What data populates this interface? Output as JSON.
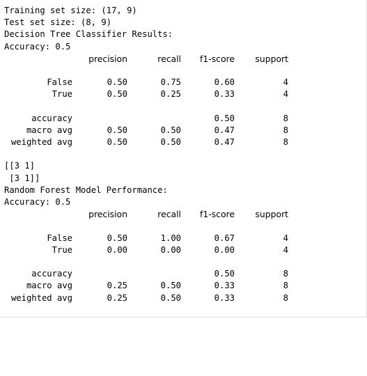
{
  "output": {
    "train_line": "Training set size: (17, 9)",
    "test_line": "Test set size: (8, 9)",
    "dt_title": "Decision Tree Classifier Results:",
    "dt_accuracy": "Accuracy: 0.5",
    "dt_report": {
      "headers": [
        "precision",
        "recall",
        "f1-score",
        "support"
      ],
      "rows": [
        {
          "label": "False",
          "precision": "0.50",
          "recall": "0.75",
          "f1": "0.60",
          "support": "4"
        },
        {
          "label": "True",
          "precision": "0.50",
          "recall": "0.25",
          "f1": "0.33",
          "support": "4"
        }
      ],
      "summary": [
        {
          "label": "accuracy",
          "precision": "",
          "recall": "",
          "f1": "0.50",
          "support": "8"
        },
        {
          "label": "macro avg",
          "precision": "0.50",
          "recall": "0.50",
          "f1": "0.47",
          "support": "8"
        },
        {
          "label": "weighted avg",
          "precision": "0.50",
          "recall": "0.50",
          "f1": "0.47",
          "support": "8"
        }
      ]
    },
    "confusion_line1": "[[3 1]",
    "confusion_line2": " [3 1]]",
    "rf_title": "Random Forest Model Performance:",
    "rf_accuracy": "Accuracy: 0.5",
    "rf_report": {
      "headers": [
        "precision",
        "recall",
        "f1-score",
        "support"
      ],
      "rows": [
        {
          "label": "False",
          "precision": "0.50",
          "recall": "1.00",
          "f1": "0.67",
          "support": "4"
        },
        {
          "label": "True",
          "precision": "0.00",
          "recall": "0.00",
          "f1": "0.00",
          "support": "4"
        }
      ],
      "summary": [
        {
          "label": "accuracy",
          "precision": "",
          "recall": "",
          "f1": "0.50",
          "support": "8"
        },
        {
          "label": "macro avg",
          "precision": "0.25",
          "recall": "0.50",
          "f1": "0.33",
          "support": "8"
        },
        {
          "label": "weighted avg",
          "precision": "0.25",
          "recall": "0.50",
          "f1": "0.33",
          "support": "8"
        }
      ]
    }
  }
}
